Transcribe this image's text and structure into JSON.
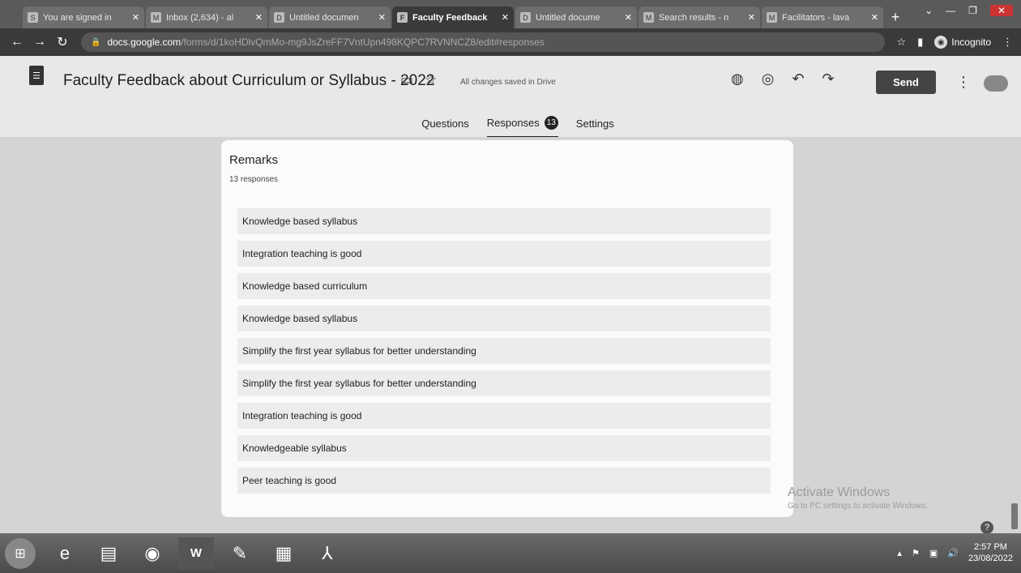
{
  "browser": {
    "tabs": [
      {
        "label": "You are signed in",
        "favicon": "S",
        "active": false
      },
      {
        "label": "Inbox (2,634) - al",
        "favicon": "M",
        "active": false
      },
      {
        "label": "Untitled documen",
        "favicon": "D",
        "active": false
      },
      {
        "label": "Faculty Feedback",
        "favicon": "F",
        "active": true
      },
      {
        "label": "Untitled docume",
        "favicon": "D",
        "active": false
      },
      {
        "label": "Search results - n",
        "favicon": "M",
        "active": false
      },
      {
        "label": "Facilitators - lava",
        "favicon": "M",
        "active": false
      }
    ],
    "url_host": "docs.google.com",
    "url_path": "/forms/d/1koHDlvQmMo-mg9JsZreFF7VntUpn498KQPC7RVNNCZ8/edit#responses",
    "profile_label": "Incognito"
  },
  "form": {
    "title": "Faculty Feedback about Curriculum or Syllabus - 2022",
    "saved_status": "All changes saved in Drive",
    "send_label": "Send",
    "tabs": {
      "questions": "Questions",
      "responses": "Responses",
      "responses_count": "13",
      "settings": "Settings"
    }
  },
  "question": {
    "title": "Remarks",
    "count_label": "13 responses",
    "responses": [
      "Knowledge based syllabus",
      "Integration teaching is good",
      "Knowledge based curriculum",
      "Knowledge based syllabus",
      "Simplify the first year syllabus for better understanding",
      "Simplify the first year syllabus for better understanding",
      "Integration teaching is good",
      "Knowledgeable syllabus",
      "Peer teaching is good"
    ]
  },
  "watermark": {
    "line1": "Activate Windows",
    "line2": "Go to PC settings to activate Windows."
  },
  "taskbar": {
    "time": "2:57 PM",
    "date": "23/08/2022"
  }
}
